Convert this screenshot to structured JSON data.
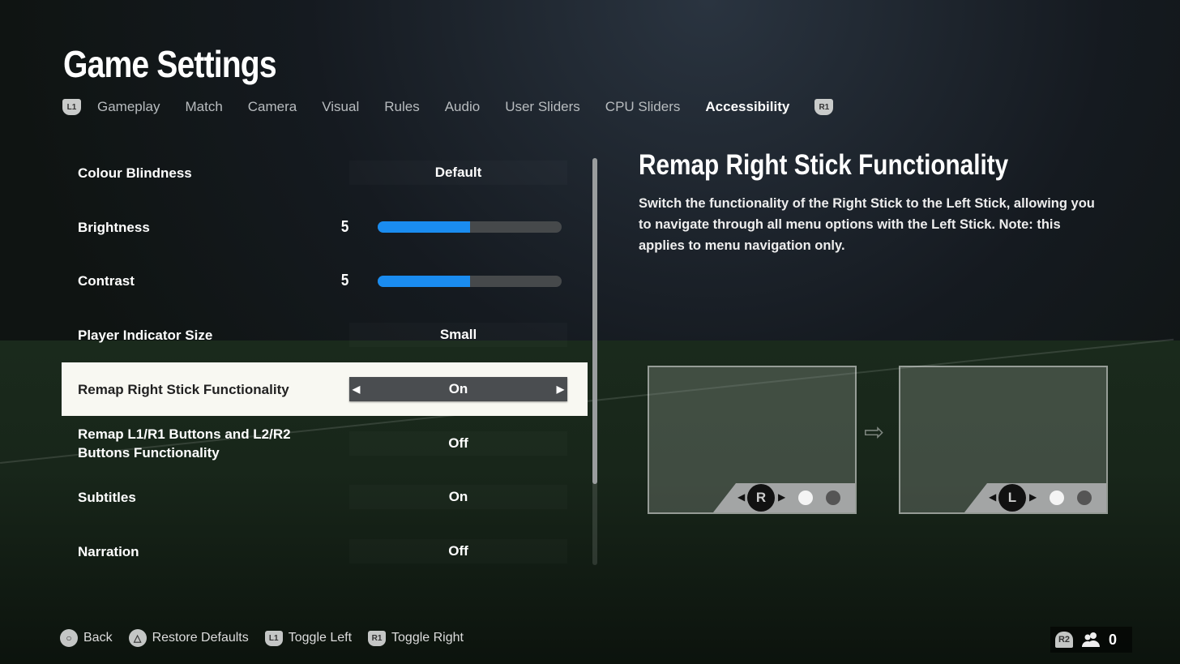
{
  "header": {
    "title": "Game Settings",
    "left_badge": "L1",
    "right_badge": "R1",
    "tabs": [
      {
        "label": "Gameplay"
      },
      {
        "label": "Match"
      },
      {
        "label": "Camera"
      },
      {
        "label": "Visual"
      },
      {
        "label": "Rules"
      },
      {
        "label": "Audio"
      },
      {
        "label": "User Sliders"
      },
      {
        "label": "CPU Sliders"
      },
      {
        "label": "Accessibility",
        "active": true
      }
    ]
  },
  "settings": [
    {
      "label": "Colour Blindness",
      "value": "Default"
    },
    {
      "label": "Brightness",
      "value": "5",
      "slider_fraction": 0.5
    },
    {
      "label": "Contrast",
      "value": "5",
      "slider_fraction": 0.5
    },
    {
      "label": "Player Indicator Size",
      "value": "Small"
    },
    {
      "label": "Remap Right Stick Functionality",
      "value": "On",
      "selected": true
    },
    {
      "label": "Remap L1/R1 Buttons and L2/R2 Buttons Functionality",
      "value": "Off"
    },
    {
      "label": "Subtitles",
      "value": "On"
    },
    {
      "label": "Narration",
      "value": "Off"
    }
  ],
  "detail": {
    "title": "Remap Right Stick Functionality",
    "description": "Switch the functionality of the Right Stick to the Left Stick, allowing you to navigate through all menu options with the Left Stick. Note: this applies to menu navigation only.",
    "before_stick": "R",
    "after_stick": "L"
  },
  "footer": {
    "back": "Back",
    "restore": "Restore Defaults",
    "toggle_left": "Toggle Left",
    "toggle_right": "Toggle Right",
    "l1": "L1",
    "r1": "R1",
    "r2": "R2",
    "player_count": "0"
  },
  "colors": {
    "accent": "#1a8cf0",
    "selected_row": "#f8f8f2"
  }
}
